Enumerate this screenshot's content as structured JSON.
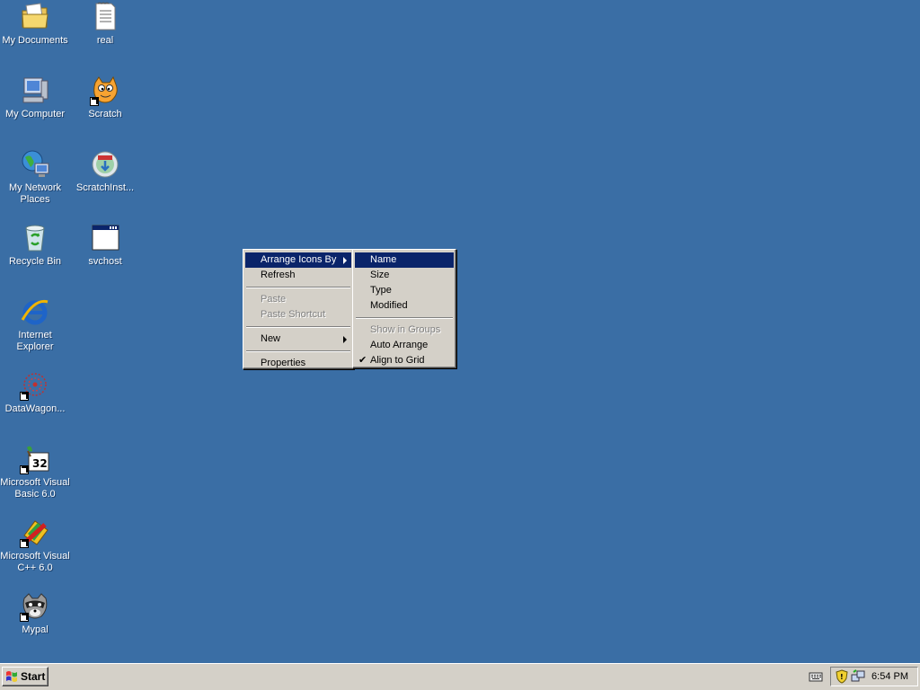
{
  "desktop": {
    "icons": [
      {
        "label": "My Documents",
        "icon": "my-documents-icon"
      },
      {
        "label": "real",
        "icon": "text-file-icon"
      },
      {
        "label": "My Computer",
        "icon": "my-computer-icon"
      },
      {
        "label": "Scratch",
        "icon": "scratch-cat-icon"
      },
      {
        "label": "My Network Places",
        "icon": "network-places-icon"
      },
      {
        "label": "ScratchInst...",
        "icon": "installer-disc-icon"
      },
      {
        "label": "Recycle Bin",
        "icon": "recycle-bin-icon"
      },
      {
        "label": "svchost",
        "icon": "window-app-icon"
      },
      {
        "label": "Internet Explorer",
        "icon": "internet-explorer-icon"
      },
      {
        "label": "DataWagon...",
        "icon": "datawagon-icon"
      },
      {
        "label": "Microsoft Visual Basic 6.0",
        "icon": "visual-basic-icon"
      },
      {
        "label": "Microsoft Visual C++ 6.0",
        "icon": "visual-cpp-icon"
      },
      {
        "label": "Mypal",
        "icon": "mypal-raccoon-icon"
      }
    ]
  },
  "context_menu": {
    "items": [
      {
        "label": "Arrange Icons By",
        "submenu": true,
        "highlighted": true
      },
      {
        "label": "Refresh"
      },
      {
        "label": "Paste",
        "disabled": true
      },
      {
        "label": "Paste Shortcut",
        "disabled": true
      },
      {
        "label": "New",
        "submenu": true
      },
      {
        "label": "Properties"
      }
    ]
  },
  "submenu": {
    "items": [
      {
        "label": "Name",
        "highlighted": true
      },
      {
        "label": "Size"
      },
      {
        "label": "Type"
      },
      {
        "label": "Modified"
      },
      {
        "label": "Show in Groups",
        "disabled": true
      },
      {
        "label": "Auto Arrange"
      },
      {
        "label": "Align to Grid",
        "checked": true
      }
    ]
  },
  "taskbar": {
    "start_label": "Start",
    "clock": "6:54 PM"
  },
  "colors": {
    "desktop": "#3a6ea5",
    "menu_highlight": "#0a246a",
    "menu_face": "#d4d0c8"
  }
}
